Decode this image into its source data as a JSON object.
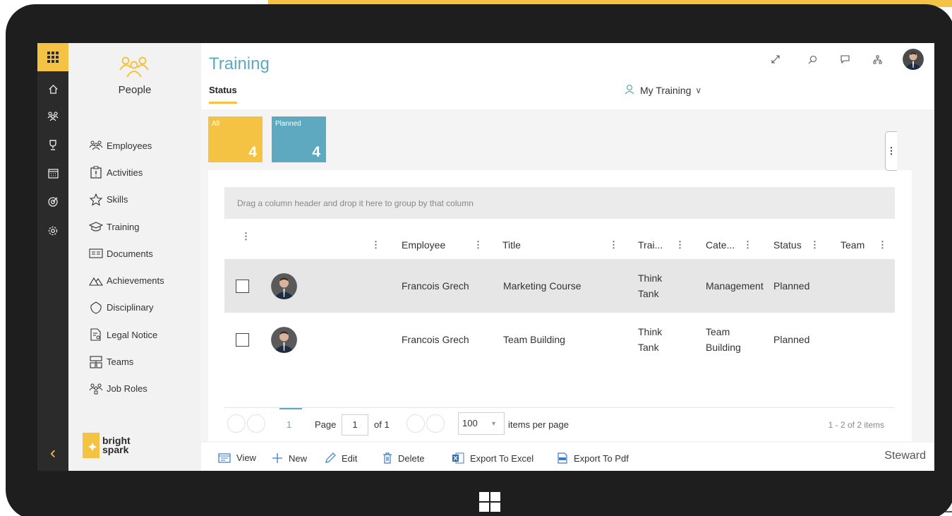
{
  "theme": {
    "accent_yellow": "#f5c343",
    "accent_teal": "#5ea9c0",
    "rail_bg": "#2b2b2b"
  },
  "rail": {
    "icons": [
      "apps-grid-icon",
      "home-icon",
      "people-icon",
      "trophy-icon",
      "calendar-icon",
      "target-icon",
      "settings-icon",
      "back-chevron-icon"
    ]
  },
  "nav": {
    "module_label": "People",
    "items": [
      {
        "label": "Employees",
        "icon": "people-icon"
      },
      {
        "label": "Activities",
        "icon": "clipboard-icon"
      },
      {
        "label": "Skills",
        "icon": "star-icon"
      },
      {
        "label": "Training",
        "icon": "graduation-cap-icon"
      },
      {
        "label": "Documents",
        "icon": "document-icon"
      },
      {
        "label": "Achievements",
        "icon": "mountain-icon"
      },
      {
        "label": "Disciplinary",
        "icon": "shield-icon"
      },
      {
        "label": "Legal Notice",
        "icon": "legal-doc-icon"
      },
      {
        "label": "Teams",
        "icon": "org-chart-icon"
      },
      {
        "label": "Job Roles",
        "icon": "role-icon"
      }
    ],
    "logo_line1": "bright",
    "logo_line2": "spark"
  },
  "header": {
    "title": "Training",
    "tab": "Status",
    "scope_label": "My Training",
    "scope_chevron": "∨",
    "action_icons": [
      "expand-icon",
      "search-icon",
      "chat-icon",
      "org-icon",
      "user-avatar"
    ]
  },
  "tiles": [
    {
      "label": "All",
      "count": "4",
      "color": "#f5c343"
    },
    {
      "label": "Planned",
      "count": "4",
      "color": "#5ea9c0"
    }
  ],
  "grid": {
    "group_hint": "Drag a column header and drop it here to group by that column",
    "columns": [
      "Employee",
      "Title",
      "Trai...",
      "Cate...",
      "Status",
      "Team"
    ],
    "rows": [
      {
        "employee": "Francois Grech",
        "title": "Marketing Course",
        "trainer_1": "Think",
        "trainer_2": "Tank",
        "category_1": "Management",
        "category_2": "",
        "status": "Planned",
        "team": ""
      },
      {
        "employee": "Francois Grech",
        "title": "Team Building",
        "trainer_1": "Think",
        "trainer_2": "Tank",
        "category_1": "Team",
        "category_2": "Building",
        "status": "Planned",
        "team": ""
      }
    ]
  },
  "pager": {
    "current_page": "1",
    "page_label": "Page",
    "page_input": "1",
    "of_label": "of 1",
    "per_page_value": "100",
    "per_page_label": "items per page",
    "summary": "1 - 2 of 2 items"
  },
  "toolbar": {
    "view": "View",
    "new": "New",
    "edit": "Edit",
    "delete": "Delete",
    "export_excel": "Export To Excel",
    "export_pdf": "Export To Pdf",
    "user_role": "Steward"
  }
}
